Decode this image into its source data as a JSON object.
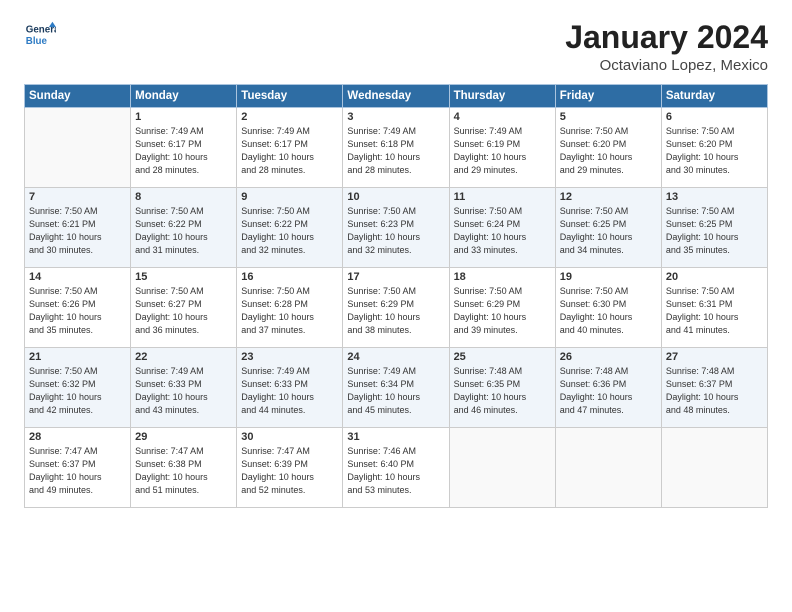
{
  "logo": {
    "line1": "General",
    "line2": "Blue"
  },
  "title": "January 2024",
  "subtitle": "Octaviano Lopez, Mexico",
  "header_days": [
    "Sunday",
    "Monday",
    "Tuesday",
    "Wednesday",
    "Thursday",
    "Friday",
    "Saturday"
  ],
  "weeks": [
    [
      {
        "day": "",
        "info": ""
      },
      {
        "day": "1",
        "info": "Sunrise: 7:49 AM\nSunset: 6:17 PM\nDaylight: 10 hours\nand 28 minutes."
      },
      {
        "day": "2",
        "info": "Sunrise: 7:49 AM\nSunset: 6:17 PM\nDaylight: 10 hours\nand 28 minutes."
      },
      {
        "day": "3",
        "info": "Sunrise: 7:49 AM\nSunset: 6:18 PM\nDaylight: 10 hours\nand 28 minutes."
      },
      {
        "day": "4",
        "info": "Sunrise: 7:49 AM\nSunset: 6:19 PM\nDaylight: 10 hours\nand 29 minutes."
      },
      {
        "day": "5",
        "info": "Sunrise: 7:50 AM\nSunset: 6:20 PM\nDaylight: 10 hours\nand 29 minutes."
      },
      {
        "day": "6",
        "info": "Sunrise: 7:50 AM\nSunset: 6:20 PM\nDaylight: 10 hours\nand 30 minutes."
      }
    ],
    [
      {
        "day": "7",
        "info": "Sunrise: 7:50 AM\nSunset: 6:21 PM\nDaylight: 10 hours\nand 30 minutes."
      },
      {
        "day": "8",
        "info": "Sunrise: 7:50 AM\nSunset: 6:22 PM\nDaylight: 10 hours\nand 31 minutes."
      },
      {
        "day": "9",
        "info": "Sunrise: 7:50 AM\nSunset: 6:22 PM\nDaylight: 10 hours\nand 32 minutes."
      },
      {
        "day": "10",
        "info": "Sunrise: 7:50 AM\nSunset: 6:23 PM\nDaylight: 10 hours\nand 32 minutes."
      },
      {
        "day": "11",
        "info": "Sunrise: 7:50 AM\nSunset: 6:24 PM\nDaylight: 10 hours\nand 33 minutes."
      },
      {
        "day": "12",
        "info": "Sunrise: 7:50 AM\nSunset: 6:25 PM\nDaylight: 10 hours\nand 34 minutes."
      },
      {
        "day": "13",
        "info": "Sunrise: 7:50 AM\nSunset: 6:25 PM\nDaylight: 10 hours\nand 35 minutes."
      }
    ],
    [
      {
        "day": "14",
        "info": "Sunrise: 7:50 AM\nSunset: 6:26 PM\nDaylight: 10 hours\nand 35 minutes."
      },
      {
        "day": "15",
        "info": "Sunrise: 7:50 AM\nSunset: 6:27 PM\nDaylight: 10 hours\nand 36 minutes."
      },
      {
        "day": "16",
        "info": "Sunrise: 7:50 AM\nSunset: 6:28 PM\nDaylight: 10 hours\nand 37 minutes."
      },
      {
        "day": "17",
        "info": "Sunrise: 7:50 AM\nSunset: 6:29 PM\nDaylight: 10 hours\nand 38 minutes."
      },
      {
        "day": "18",
        "info": "Sunrise: 7:50 AM\nSunset: 6:29 PM\nDaylight: 10 hours\nand 39 minutes."
      },
      {
        "day": "19",
        "info": "Sunrise: 7:50 AM\nSunset: 6:30 PM\nDaylight: 10 hours\nand 40 minutes."
      },
      {
        "day": "20",
        "info": "Sunrise: 7:50 AM\nSunset: 6:31 PM\nDaylight: 10 hours\nand 41 minutes."
      }
    ],
    [
      {
        "day": "21",
        "info": "Sunrise: 7:50 AM\nSunset: 6:32 PM\nDaylight: 10 hours\nand 42 minutes."
      },
      {
        "day": "22",
        "info": "Sunrise: 7:49 AM\nSunset: 6:33 PM\nDaylight: 10 hours\nand 43 minutes."
      },
      {
        "day": "23",
        "info": "Sunrise: 7:49 AM\nSunset: 6:33 PM\nDaylight: 10 hours\nand 44 minutes."
      },
      {
        "day": "24",
        "info": "Sunrise: 7:49 AM\nSunset: 6:34 PM\nDaylight: 10 hours\nand 45 minutes."
      },
      {
        "day": "25",
        "info": "Sunrise: 7:48 AM\nSunset: 6:35 PM\nDaylight: 10 hours\nand 46 minutes."
      },
      {
        "day": "26",
        "info": "Sunrise: 7:48 AM\nSunset: 6:36 PM\nDaylight: 10 hours\nand 47 minutes."
      },
      {
        "day": "27",
        "info": "Sunrise: 7:48 AM\nSunset: 6:37 PM\nDaylight: 10 hours\nand 48 minutes."
      }
    ],
    [
      {
        "day": "28",
        "info": "Sunrise: 7:47 AM\nSunset: 6:37 PM\nDaylight: 10 hours\nand 49 minutes."
      },
      {
        "day": "29",
        "info": "Sunrise: 7:47 AM\nSunset: 6:38 PM\nDaylight: 10 hours\nand 51 minutes."
      },
      {
        "day": "30",
        "info": "Sunrise: 7:47 AM\nSunset: 6:39 PM\nDaylight: 10 hours\nand 52 minutes."
      },
      {
        "day": "31",
        "info": "Sunrise: 7:46 AM\nSunset: 6:40 PM\nDaylight: 10 hours\nand 53 minutes."
      },
      {
        "day": "",
        "info": ""
      },
      {
        "day": "",
        "info": ""
      },
      {
        "day": "",
        "info": ""
      }
    ]
  ]
}
